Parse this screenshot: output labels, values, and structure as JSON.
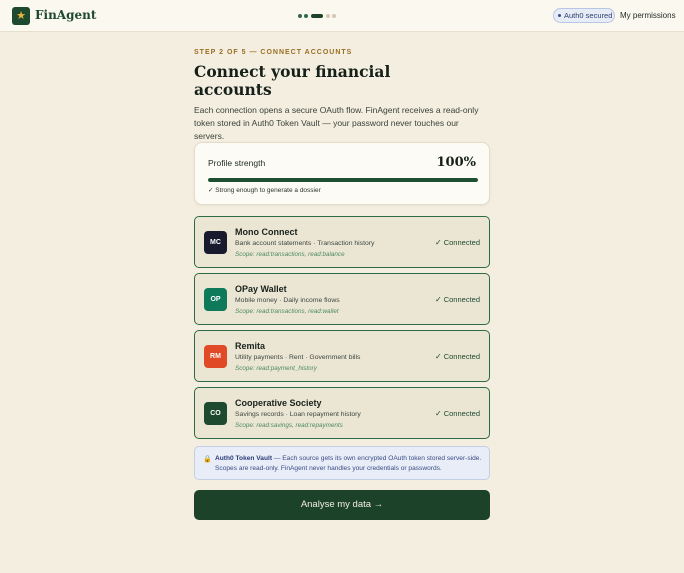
{
  "header": {
    "logo_glyph": "★",
    "brand": "FinAgent",
    "steps_total": 5,
    "steps_current": 3,
    "auth_badge": "Auth0 secured",
    "permissions_link": "My permissions"
  },
  "main": {
    "eyebrow": "STEP 2 OF 5 — CONNECT ACCOUNTS",
    "title": "Connect your financial accounts",
    "intro": "Each connection opens a secure OAuth flow. FinAgent receives a read-only token stored in Auth0 Token Vault — your password never touches our servers."
  },
  "strength": {
    "label": "Profile strength",
    "value": "100%",
    "fraction": 1.0,
    "note": "✓ Strong enough to generate a dossier"
  },
  "accounts": [
    {
      "initials": "MC",
      "name": "Mono Connect",
      "desc": "Bank account statements · Transaction history",
      "scope": "Scope: read:transactions, read:balance",
      "status": "Connected",
      "color": "#1a1a2e"
    },
    {
      "initials": "OP",
      "name": "OPay Wallet",
      "desc": "Mobile money · Daily income flows",
      "scope": "Scope: read:transactions, read:wallet",
      "status": "Connected",
      "color": "#0f7a5a"
    },
    {
      "initials": "RM",
      "name": "Remita",
      "desc": "Utility payments · Rent · Government bills",
      "scope": "Scope: read:payment_history",
      "status": "Connected",
      "color": "#e04a26"
    },
    {
      "initials": "CO",
      "name": "Cooperative Society",
      "desc": "Savings records · Loan repayment history",
      "scope": "Scope: read:savings, read:repayments",
      "status": "Connected",
      "color": "#1d4a2e"
    }
  ],
  "vault": {
    "icon": "lock-icon",
    "title": "Auth0 Token Vault",
    "text": " — Each source gets its own encrypted OAuth token stored server-side. Scopes are read-only. FinAgent never handles your credentials or passwords."
  },
  "cta": {
    "label": "Analyse my data →"
  },
  "colors": {
    "background": "#f4eee0",
    "primary": "#1c4229",
    "accent_gold": "#9a6e23",
    "connected_border": "#2e6b44"
  }
}
